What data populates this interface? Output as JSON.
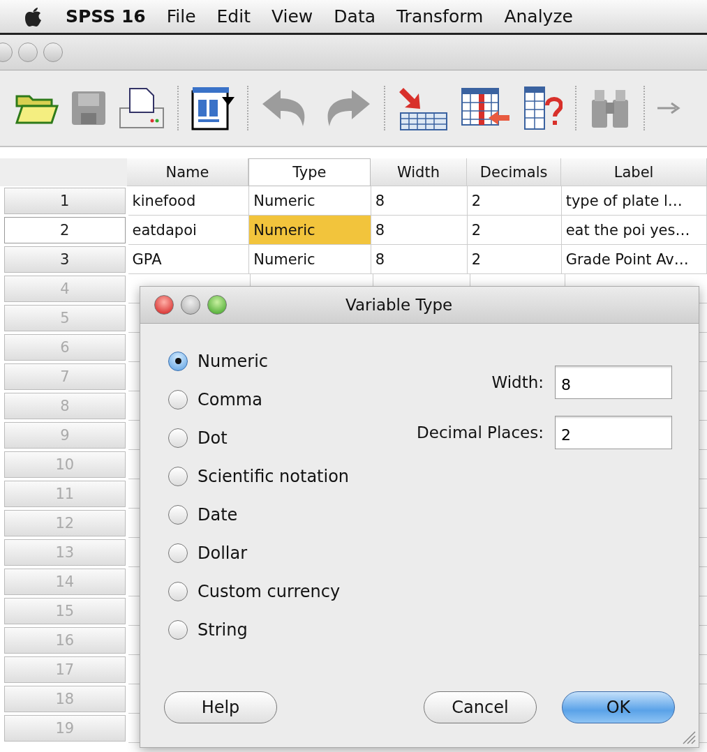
{
  "menu_bar": {
    "app_name": "SPSS 16",
    "items": [
      "File",
      "Edit",
      "View",
      "Data",
      "Transform",
      "Analyze"
    ]
  },
  "grid": {
    "columns": [
      {
        "label": "Name",
        "selected": false
      },
      {
        "label": "Type",
        "selected": true
      },
      {
        "label": "Width",
        "selected": false
      },
      {
        "label": "Decimals",
        "selected": false
      },
      {
        "label": "Label",
        "selected": false
      }
    ],
    "rows": [
      {
        "number": "1",
        "selected": false,
        "cells": [
          {
            "text": "kinefood",
            "selected": false
          },
          {
            "text": "Numeric",
            "selected": false
          },
          {
            "text": "8",
            "selected": false
          },
          {
            "text": "2",
            "selected": false
          },
          {
            "text": "type of plate l…",
            "selected": false
          }
        ]
      },
      {
        "number": "2",
        "selected": true,
        "cells": [
          {
            "text": "eatdapoi",
            "selected": false
          },
          {
            "text": "Numeric",
            "selected": true
          },
          {
            "text": "8",
            "selected": false
          },
          {
            "text": "2",
            "selected": false
          },
          {
            "text": "eat the poi yes…",
            "selected": false
          }
        ]
      },
      {
        "number": "3",
        "selected": false,
        "cells": [
          {
            "text": "GPA",
            "selected": false
          },
          {
            "text": "Numeric",
            "selected": false
          },
          {
            "text": "8",
            "selected": false
          },
          {
            "text": "2",
            "selected": false
          },
          {
            "text": "Grade Point Av…",
            "selected": false
          }
        ]
      },
      {
        "number": "4",
        "selected": false
      },
      {
        "number": "5",
        "selected": false
      },
      {
        "number": "6",
        "selected": false
      },
      {
        "number": "7",
        "selected": false
      },
      {
        "number": "8",
        "selected": false
      },
      {
        "number": "9",
        "selected": false
      },
      {
        "number": "10",
        "selected": false
      },
      {
        "number": "11",
        "selected": false
      },
      {
        "number": "12",
        "selected": false
      },
      {
        "number": "13",
        "selected": false
      },
      {
        "number": "14",
        "selected": false
      },
      {
        "number": "15",
        "selected": false
      },
      {
        "number": "16",
        "selected": false
      },
      {
        "number": "17",
        "selected": false
      },
      {
        "number": "18",
        "selected": false
      },
      {
        "number": "19",
        "selected": false
      }
    ]
  },
  "dialog": {
    "title": "Variable Type",
    "options": [
      {
        "label": "Numeric",
        "selected": true
      },
      {
        "label": "Comma",
        "selected": false
      },
      {
        "label": "Dot",
        "selected": false
      },
      {
        "label": "Scientific notation",
        "selected": false
      },
      {
        "label": "Date",
        "selected": false
      },
      {
        "label": "Dollar",
        "selected": false
      },
      {
        "label": "Custom currency",
        "selected": false
      },
      {
        "label": "String",
        "selected": false
      }
    ],
    "fields": [
      {
        "label": "Width:",
        "value": "8"
      },
      {
        "label": "Decimal Places:",
        "value": "2"
      }
    ],
    "buttons": [
      {
        "label": "Help",
        "kind": "help"
      },
      {
        "label": "Cancel",
        "kind": "normal"
      },
      {
        "label": "OK",
        "kind": "default"
      }
    ]
  }
}
